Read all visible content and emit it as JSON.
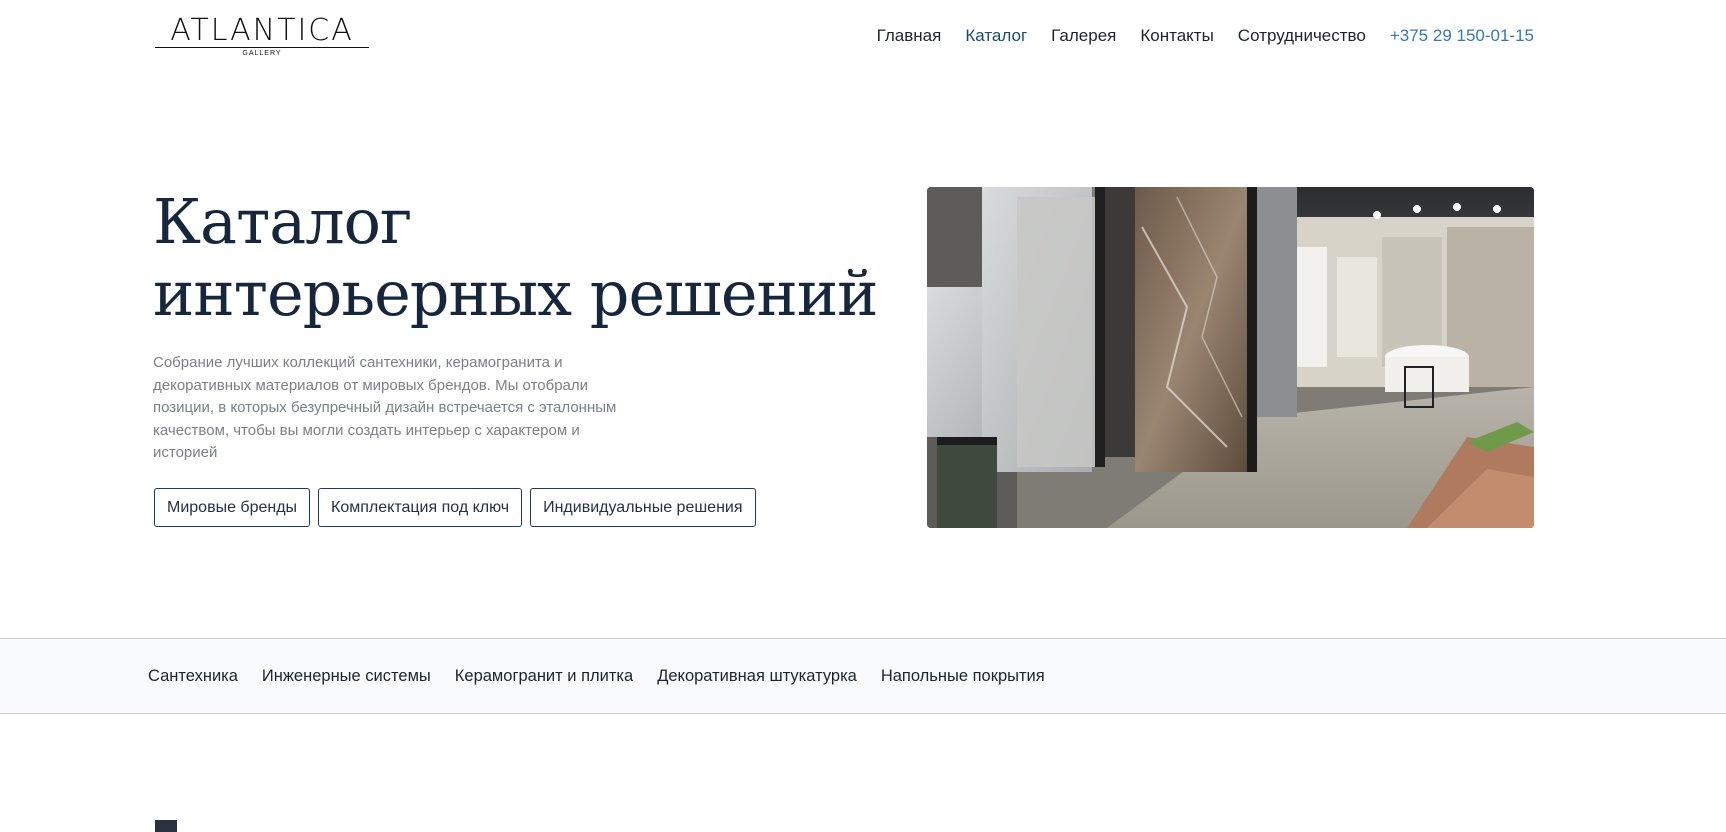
{
  "header": {
    "logo": {
      "word": "ATLANTICA",
      "sub": "GALLERY"
    },
    "nav": [
      {
        "label": "Главная",
        "active": false
      },
      {
        "label": "Каталог",
        "active": true
      },
      {
        "label": "Галерея",
        "active": false
      },
      {
        "label": "Контакты",
        "active": false
      },
      {
        "label": "Сотрудничество",
        "active": false
      }
    ],
    "phone": "+375 29 150-01-15"
  },
  "hero": {
    "title_line1": "Каталог",
    "title_line2": "интерьерных решений",
    "description": "Собрание лучших коллекций сантехники, керамогранита и декоративных материалов от мировых брендов. Мы отобрали позиции, в которых безупречный дизайн встречается с эталонным качеством, чтобы вы могли создать интерьер с характером и историей",
    "buttons": [
      {
        "label": "Мировые бренды"
      },
      {
        "label": "Комплектация под ключ"
      },
      {
        "label": "Индивидуальные решения"
      }
    ]
  },
  "categories": [
    {
      "label": "Сантехника"
    },
    {
      "label": "Инженерные системы"
    },
    {
      "label": "Керамогранит и плитка"
    },
    {
      "label": "Декоративная штукатурка"
    },
    {
      "label": "Напольные покрытия"
    }
  ],
  "colors": {
    "title": "#16263c",
    "accent": "#1a4c73",
    "phone": "#3478b8",
    "button_border": "#1a3d5c",
    "strip_bg": "#f8fafc"
  },
  "icons": {
    "photo": "showroom-photo"
  }
}
